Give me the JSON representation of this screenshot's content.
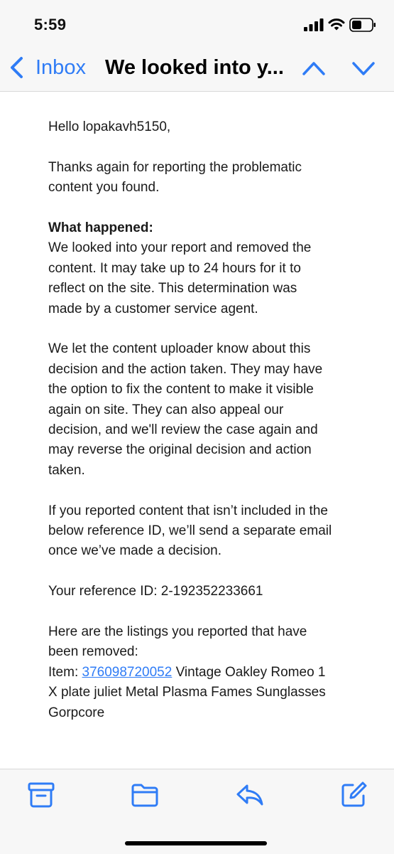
{
  "status_bar": {
    "time": "5:59",
    "icons": [
      "cellular-signal-icon",
      "wifi-icon",
      "battery-icon"
    ]
  },
  "nav": {
    "back_label": "Inbox",
    "title": "We looked into y...",
    "icons": [
      "chevron-left-icon",
      "chevron-up-icon",
      "chevron-down-icon"
    ]
  },
  "email": {
    "greeting": "Hello lopakavh5150,",
    "thanks": "Thanks again for reporting the problematic content you found.",
    "what_happened_heading": "What happened:",
    "what_happened_body": "We looked into your report and removed the content. It may take up to 24 hours for it to reflect on the site.  This determination was made by a customer service agent.",
    "uploader_paragraph": "We let the content uploader know about this decision and the action taken. They may have the option to fix the content to make it visible again on site. They can also appeal our decision, and we'll review the case again and may reverse the original decision and action taken.",
    "separate_email_paragraph": "If you reported content that isn’t included in the below reference ID, we’ll send a separate email once we’ve made a decision.",
    "reference_id": "Your reference ID: 2-192352233661",
    "listings_intro": "Here are the listings you reported that have been removed:",
    "item_prefix": "Item: ",
    "item_link": "376098720052",
    "item_title": " Vintage Oakley Romeo 1 X plate juliet Metal Plasma Fames Sunglasses Gorpcore"
  },
  "toolbar": {
    "icons": [
      "archive-icon",
      "folder-icon",
      "reply-icon",
      "compose-icon"
    ]
  },
  "colors": {
    "accent": "#2f7cf6",
    "bar_background": "#f7f7f7",
    "text": "#1a1a1a"
  }
}
